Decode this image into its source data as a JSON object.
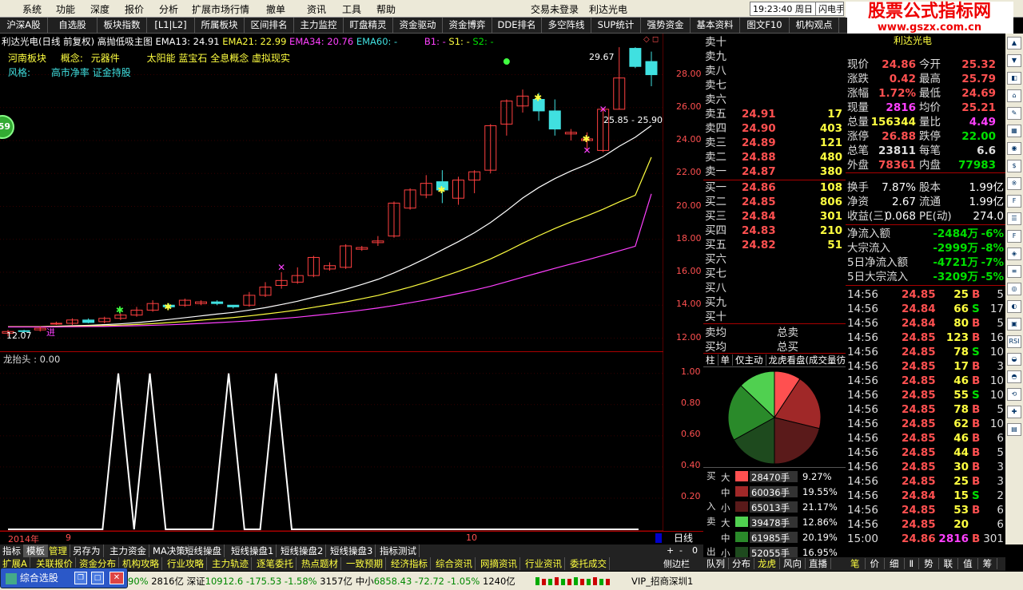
{
  "menu": [
    "系统",
    "功能",
    "深度",
    "报价",
    "分析",
    "扩展市场行情",
    "撤单",
    "资讯",
    "工具",
    "帮助"
  ],
  "login_status": "交易未登录",
  "window_stock": "利达光电",
  "clock": "19:23:40 周日",
  "flash_btn": "闪电手",
  "logo_title": "股票公式指标网",
  "logo_url": "www.gszx.com.cn",
  "toolbar": [
    "沪深A股",
    "自选股",
    "板块指数",
    "[L1|L2]",
    "所属板块",
    "区间排名",
    "主力监控",
    "盯盘精灵",
    "资金驱动",
    "资金博弈",
    "DDE排名",
    "多空阵线",
    "SUP统计",
    "强势资金",
    "基本资料",
    "图文F10",
    "机构观点"
  ],
  "chart_header": {
    "name": "利达光电(日线 前复权) 高抛低吸主图",
    "ema13": "EMA13: 24.91",
    "ema21": "EMA21: 22.99",
    "ema34": "EMA34: 20.76",
    "ema60": "EMA60: -",
    "b1": "B1: -",
    "s1": "S1: -",
    "s2": "S2: -"
  },
  "info_line1": {
    "sector": "河南板块",
    "concept_label": "概念:",
    "concept": "元器件",
    "concepts2": "太阳能 蓝宝石 全息概念 虚拟现实"
  },
  "info_line2": {
    "style_label": "风格:",
    "style": "高市净率 证金持股"
  },
  "badge": "59",
  "annotations": {
    "high": "29.67",
    "range": "25.85 - 25.90",
    "low": "12.07",
    "jin": "进"
  },
  "chart_data": [
    {
      "type": "candlestick",
      "title": "利达光电(日线 前复权) 高抛低吸主图",
      "yticks": [
        12.0,
        14.0,
        16.0,
        18.0,
        20.0,
        22.0,
        24.0,
        26.0,
        28.0
      ],
      "ylim": [
        11.2,
        30.5
      ],
      "x_labels": [
        "2014年",
        "9",
        "10"
      ],
      "candles": [
        [
          12.3,
          12.4,
          12.1,
          12.5
        ],
        [
          12.45,
          12.4,
          12.3,
          12.5
        ],
        [
          12.5,
          12.6,
          12.4,
          12.7
        ],
        [
          12.9,
          12.9,
          12.8,
          13.0
        ],
        [
          12.9,
          13.1,
          12.8,
          13.2
        ],
        [
          13.1,
          12.95,
          12.9,
          13.2
        ],
        [
          13.0,
          13.2,
          12.9,
          13.3
        ],
        [
          13.2,
          13.4,
          13.1,
          13.5
        ],
        [
          13.4,
          13.7,
          13.3,
          13.9
        ],
        [
          13.7,
          14.1,
          13.6,
          14.3
        ],
        [
          14.0,
          13.9,
          13.8,
          14.1
        ],
        [
          14.0,
          14.3,
          13.9,
          14.4
        ],
        [
          14.1,
          14.2,
          14.0,
          14.3
        ],
        [
          14.2,
          14.1,
          14.0,
          14.3
        ],
        [
          14.0,
          13.9,
          13.8,
          14.0
        ],
        [
          14.0,
          14.6,
          13.9,
          14.8
        ],
        [
          14.6,
          15.1,
          14.5,
          15.4
        ],
        [
          15.2,
          15.5,
          15.0,
          16.0
        ],
        [
          15.4,
          15.8,
          15.3,
          16.3
        ],
        [
          15.8,
          16.9,
          15.7,
          17.0
        ],
        [
          16.2,
          16.4,
          16.1,
          16.6
        ],
        [
          16.3,
          17.6,
          16.2,
          17.7
        ],
        [
          17.4,
          17.5,
          17.3,
          17.6
        ],
        [
          17.8,
          17.9,
          17.6,
          18.2
        ],
        [
          18.2,
          20.2,
          18.1,
          20.3
        ],
        [
          19.9,
          21.0,
          19.8,
          21.1
        ],
        [
          20.7,
          21.4,
          20.5,
          21.9
        ],
        [
          21.5,
          21.0,
          20.2,
          22.2
        ],
        [
          20.5,
          21.6,
          20.1,
          21.8
        ],
        [
          21.6,
          22.1,
          20.8,
          22.2
        ],
        [
          22.2,
          24.9,
          22.0,
          25.0
        ],
        [
          25.0,
          26.4,
          24.3,
          26.5
        ],
        [
          26.1,
          26.7,
          25.7,
          27.1
        ],
        [
          26.5,
          25.8,
          25.2,
          26.9
        ],
        [
          25.8,
          24.7,
          24.3,
          26.5
        ],
        [
          24.4,
          24.5,
          24.0,
          24.7
        ],
        [
          24.0,
          24.1,
          23.4,
          24.5
        ],
        [
          23.4,
          25.9,
          23.3,
          25.9
        ],
        [
          25.9,
          27.8,
          25.9,
          29.67
        ],
        [
          29.6,
          28.5,
          28.4,
          29.67
        ],
        [
          28.8,
          28.0,
          27.3,
          29.4
        ]
      ],
      "series": [
        {
          "name": "EMA13",
          "color": "#ffffff",
          "values": [
            12.7,
            12.7,
            12.7,
            12.72,
            12.75,
            12.78,
            12.82,
            12.87,
            12.94,
            13.03,
            13.13,
            13.24,
            13.35,
            13.46,
            13.56,
            13.7,
            13.85,
            14.04,
            14.24,
            14.48,
            14.71,
            14.97,
            15.26,
            15.57,
            15.96,
            16.39,
            16.86,
            17.36,
            17.86,
            18.4,
            19.02,
            19.74,
            20.51,
            21.15,
            21.69,
            22.15,
            22.55,
            23.02,
            23.65,
            24.2,
            24.91
          ]
        },
        {
          "name": "EMA21",
          "color": "#ffff40",
          "values": [
            12.7,
            12.7,
            12.7,
            12.71,
            12.72,
            12.74,
            12.76,
            12.79,
            12.83,
            12.88,
            12.94,
            13.01,
            13.09,
            13.17,
            13.25,
            13.35,
            13.46,
            13.58,
            13.71,
            13.87,
            14.03,
            14.2,
            14.39,
            14.59,
            14.84,
            15.1,
            15.39,
            15.72,
            16.05,
            16.41,
            16.81,
            17.27,
            17.76,
            18.22,
            18.66,
            19.06,
            19.43,
            19.83,
            20.27,
            20.68,
            22.99
          ]
        },
        {
          "name": "EMA34",
          "color": "#ff40ff",
          "values": [
            12.68,
            12.68,
            12.68,
            12.68,
            12.69,
            12.7,
            12.71,
            12.73,
            12.75,
            12.78,
            12.81,
            12.85,
            12.89,
            12.94,
            12.99,
            13.05,
            13.12,
            13.19,
            13.27,
            13.37,
            13.47,
            13.58,
            13.7,
            13.83,
            13.98,
            14.15,
            14.32,
            14.51,
            14.71,
            14.92,
            15.15,
            15.42,
            15.7,
            15.97,
            16.24,
            16.5,
            16.75,
            17.02,
            17.3,
            17.58,
            20.76
          ]
        }
      ]
    },
    {
      "type": "line",
      "title": "龙抬头 : 0.00",
      "yticks": [
        0.2,
        0.4,
        0.6,
        0.8,
        1.0
      ],
      "ylim": [
        0,
        1.05
      ],
      "x": [
        0,
        1,
        2,
        3,
        4,
        5,
        6,
        7,
        8,
        9,
        10,
        11,
        12,
        13,
        14,
        15,
        16,
        17,
        18,
        19,
        20,
        21,
        22,
        23,
        24,
        25,
        26,
        27,
        28,
        29,
        30,
        31,
        32,
        33,
        34,
        35,
        36,
        37,
        38,
        39,
        40
      ],
      "values": [
        0,
        0,
        0,
        0,
        0,
        0,
        0,
        1,
        0,
        1,
        0,
        0,
        0,
        0,
        1,
        0,
        0,
        1,
        0,
        0,
        0,
        0,
        0,
        0,
        0,
        0,
        0,
        0,
        0,
        0,
        0,
        0,
        0,
        0,
        0,
        0,
        0,
        0,
        0,
        0,
        0
      ]
    },
    {
      "type": "pie",
      "title": "龙虎看盘",
      "slices": [
        {
          "label": "买大",
          "value": 9.27,
          "color": "#ff5050"
        },
        {
          "label": "买中",
          "value": 19.55,
          "color": "#a02828"
        },
        {
          "label": "买小",
          "value": 21.17,
          "color": "#5a1a1a"
        },
        {
          "label": "卖小",
          "value": 16.95,
          "color": "#1e4a1e"
        },
        {
          "label": "卖中",
          "value": 20.19,
          "color": "#2a8a2a"
        },
        {
          "label": "卖大",
          "value": 12.86,
          "color": "#50d050"
        }
      ]
    }
  ],
  "orderbook": {
    "sell": [
      {
        "l": "卖十",
        "p": "",
        "v": ""
      },
      {
        "l": "卖九",
        "p": "",
        "v": ""
      },
      {
        "l": "卖八",
        "p": "",
        "v": ""
      },
      {
        "l": "卖七",
        "p": "",
        "v": ""
      },
      {
        "l": "卖六",
        "p": "",
        "v": ""
      },
      {
        "l": "卖五",
        "p": "24.91",
        "v": "17"
      },
      {
        "l": "卖四",
        "p": "24.90",
        "v": "403"
      },
      {
        "l": "卖三",
        "p": "24.89",
        "v": "121"
      },
      {
        "l": "卖二",
        "p": "24.88",
        "v": "480"
      },
      {
        "l": "卖一",
        "p": "24.87",
        "v": "380"
      }
    ],
    "buy": [
      {
        "l": "买一",
        "p": "24.86",
        "v": "108"
      },
      {
        "l": "买二",
        "p": "24.85",
        "v": "806"
      },
      {
        "l": "买三",
        "p": "24.84",
        "v": "301"
      },
      {
        "l": "买四",
        "p": "24.83",
        "v": "210"
      },
      {
        "l": "买五",
        "p": "24.82",
        "v": "51"
      },
      {
        "l": "买六",
        "p": "",
        "v": ""
      },
      {
        "l": "买七",
        "p": "",
        "v": ""
      },
      {
        "l": "买八",
        "p": "",
        "v": ""
      },
      {
        "l": "买九",
        "p": "",
        "v": ""
      },
      {
        "l": "买十",
        "p": "",
        "v": ""
      }
    ],
    "avg_sell": "卖均",
    "avg_buy": "买均",
    "total_sell": "总卖",
    "total_buy": "总买"
  },
  "pie_tabs": [
    "柱",
    "单",
    "仅主动",
    "龙虎看盘(成交量彷"
  ],
  "flow": {
    "buy_label": "买",
    "sell_label": "卖",
    "in_label": "入",
    "out_label": "出",
    "rows": [
      {
        "k": "大",
        "v": "28470手",
        "p": "9.27%",
        "c": "#ff5050"
      },
      {
        "k": "中",
        "v": "60036手",
        "p": "19.55%",
        "c": "#a02828"
      },
      {
        "k": "小",
        "v": "65013手",
        "p": "21.17%",
        "c": "#5a1a1a"
      },
      {
        "k": "大",
        "v": "39478手",
        "p": "12.86%",
        "c": "#50d050"
      },
      {
        "k": "中",
        "v": "61985手",
        "p": "20.19%",
        "c": "#2a8a2a"
      },
      {
        "k": "小",
        "v": "52055手",
        "p": "16.95%",
        "c": "#1e4a1e"
      }
    ]
  },
  "quote": {
    "header": "利达光电",
    "rows": [
      [
        "现价",
        "24.86",
        "今开",
        "25.32"
      ],
      [
        "涨跌",
        "0.42",
        "最高",
        "25.79"
      ],
      [
        "涨幅",
        "1.72%",
        "最低",
        "24.69"
      ],
      [
        "现量",
        "2816",
        "均价",
        "25.21"
      ],
      [
        "总量",
        "156344",
        "量比",
        "4.49"
      ],
      [
        "涨停",
        "26.88",
        "跌停",
        "22.00"
      ],
      [
        "总笔",
        "23811",
        "每笔",
        "6.6"
      ],
      [
        "外盘",
        "78361",
        "内盘",
        "77983"
      ]
    ],
    "rows2": [
      [
        "换手",
        "7.87%",
        "股本",
        "1.99亿"
      ],
      [
        "净资",
        "2.67",
        "流通",
        "1.99亿"
      ],
      [
        "收益(三)",
        "0.068",
        "PE(动)",
        "274.0"
      ]
    ],
    "flows": [
      [
        "净流入额",
        "-2484万",
        "-6%"
      ],
      [
        "大宗流入",
        "-2999万",
        "-8%"
      ],
      [
        "5日净流入额",
        "-4721万",
        "-7%"
      ],
      [
        "5日大宗流入",
        "-3209万",
        "-5%"
      ]
    ]
  },
  "ticks": [
    [
      "14:56",
      "24.85",
      "25",
      "B",
      "5"
    ],
    [
      "14:56",
      "24.84",
      "66",
      "S",
      "17"
    ],
    [
      "14:56",
      "24.84",
      "80",
      "B",
      "5"
    ],
    [
      "14:56",
      "24.85",
      "123",
      "B",
      "16"
    ],
    [
      "14:56",
      "24.85",
      "78",
      "S",
      "10"
    ],
    [
      "14:56",
      "24.85",
      "17",
      "B",
      "3"
    ],
    [
      "14:56",
      "24.85",
      "46",
      "B",
      "10"
    ],
    [
      "14:56",
      "24.85",
      "55",
      "S",
      "10"
    ],
    [
      "14:56",
      "24.85",
      "78",
      "B",
      "5"
    ],
    [
      "14:56",
      "24.85",
      "62",
      "B",
      "10"
    ],
    [
      "14:56",
      "24.85",
      "46",
      "B",
      "6"
    ],
    [
      "14:56",
      "24.85",
      "44",
      "B",
      "5"
    ],
    [
      "14:56",
      "24.85",
      "30",
      "B",
      "3"
    ],
    [
      "14:56",
      "24.85",
      "25",
      "B",
      "3"
    ],
    [
      "14:56",
      "24.84",
      "15",
      "S",
      "2"
    ],
    [
      "14:56",
      "24.85",
      "53",
      "B",
      "6"
    ],
    [
      "14:56",
      "24.85",
      "20",
      "",
      "6"
    ],
    [
      "15:00",
      "24.86",
      "2816",
      "B",
      "301"
    ]
  ],
  "tick_tabs": [
    "笔",
    "价",
    "细",
    "Ⅱ",
    "势",
    "联",
    "值",
    "筹"
  ],
  "right_tabs": [
    "队列",
    "分布",
    "龙虎",
    "风向",
    "直播"
  ],
  "period": "日线",
  "zoom": [
    "+",
    "-",
    "0"
  ],
  "side_bar": "侧边栏",
  "bottom1": [
    "指标",
    "模板",
    "管理",
    "另存为",
    "主力资金",
    "MA决策",
    "短线操盘",
    "短线操盘1",
    "短线操盘2",
    "短线操盘3",
    "指标测试"
  ],
  "bottom2": [
    "扩展A",
    "关联报价",
    "资金分布",
    "机构攻略",
    "行业攻略",
    "主力轨迹",
    "逐笔委托",
    "热点题材",
    "一致预期",
    "经济指标",
    "综合资讯",
    "网摘资讯",
    "行业资讯",
    "委托成交"
  ],
  "status": {
    "select": "综合选股",
    "sh_tail": "90%",
    "sh_amt": "2816亿",
    "sz_label": "深证",
    "sz_val": "10912.6",
    "sz_chg": "-175.53",
    "sz_pct": "-1.58%",
    "sz_amt": "3157亿",
    "zx_label": "中小",
    "zx_val": "6858.43",
    "zx_chg": "-72.72",
    "zx_pct": "-1.05%",
    "zx_amt": "1240亿",
    "vip": "VIP_招商深圳1"
  }
}
